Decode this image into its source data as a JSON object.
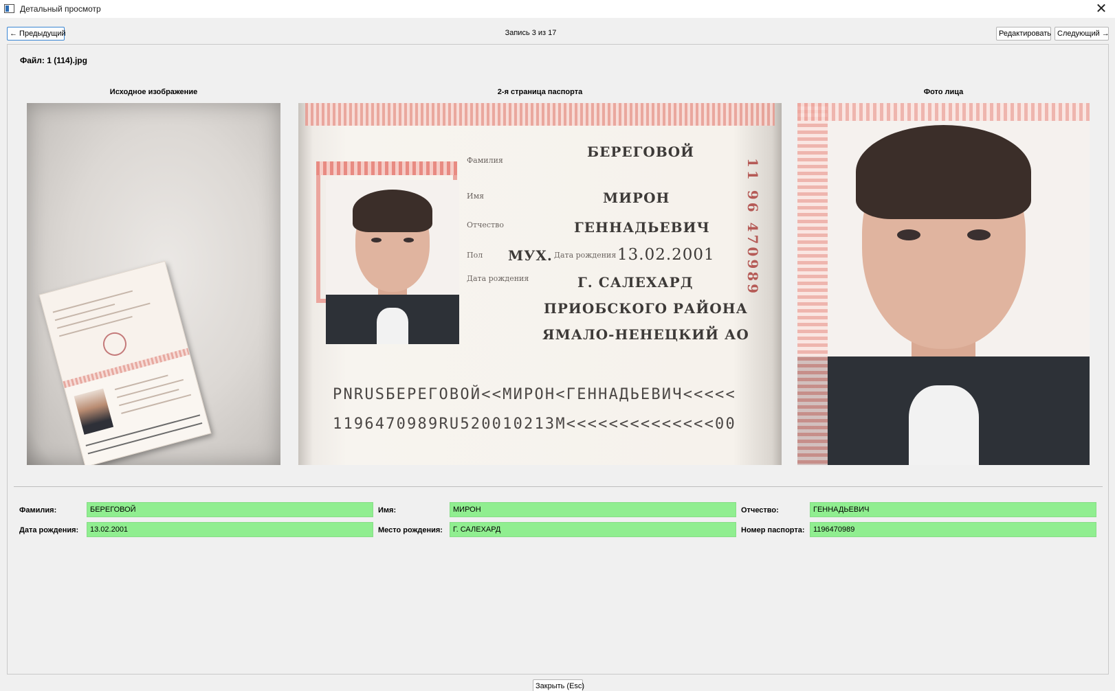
{
  "window": {
    "title": "Детальный просмотр"
  },
  "nav": {
    "prev_label": "← Предыдущий",
    "record_counter": "Запись 3 из 17",
    "edit_label": "Редактировать",
    "next_label": "Следующий →"
  },
  "file": {
    "label": "Файл: 1 (114).jpg"
  },
  "images": {
    "source_caption": "Исходное изображение",
    "passport_caption": "2-я страница паспорта",
    "face_caption": "Фото лица"
  },
  "passport_page": {
    "label_surname": "Фамилия",
    "label_name": "Имя",
    "label_patronymic": "Отчество",
    "label_sex": "Пол",
    "label_dob": "Дата рождения",
    "label_pob": "Дата рождения",
    "surname": "БЕРЕГОВОЙ",
    "name": "МИРОН",
    "patronymic": "ГЕННАДЬЕВИЧ",
    "sex": "МУХ.",
    "dob": "13.02.2001",
    "pob_line1": "Г. САЛЕХАРД",
    "pob_line2": "ПРИОБСКОГО РАЙОНА",
    "pob_line3": "ЯМАЛО-НЕНЕЦКИЙ АО",
    "vertical_number": "11 96 470989",
    "mrz_line1": "PNRUSБЕРЕГОВОЙ<<МИРОН<ГЕННАДЬЕВИЧ<<<<<",
    "mrz_line2": "1196470989RU520010213M<<<<<<<<<<<<<<00"
  },
  "fields": {
    "surname_label": "Фамилия:",
    "surname_value": "БЕРЕГОВОЙ",
    "name_label": "Имя:",
    "name_value": "МИРОН",
    "patronymic_label": "Отчество:",
    "patronymic_value": "ГЕННАДЬЕВИЧ",
    "dob_label": "Дата рождения:",
    "dob_value": "13.02.2001",
    "pob_label": "Место рождения:",
    "pob_value": "Г. САЛЕХАРД",
    "passport_label": "Номер паспорта:",
    "passport_value": "1196470989"
  },
  "footer": {
    "close_label": "Закрыть (Esc)"
  },
  "colors": {
    "field_ok": "#90ee90",
    "focus_border": "#3a86d3"
  },
  "icons": {
    "app": "window-icon",
    "close": "close-icon"
  }
}
